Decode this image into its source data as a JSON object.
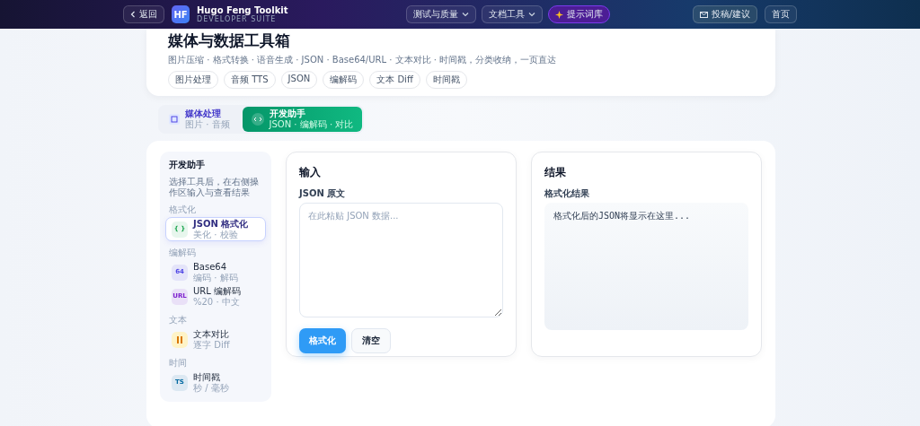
{
  "header": {
    "back": "返回",
    "logo": "HF",
    "title": "Hugo Feng Toolkit",
    "subtitle": "DEVELOPER SUITE",
    "nav": [
      {
        "label": "测试与质量",
        "kind": "dropdown"
      },
      {
        "label": "文档工具",
        "kind": "dropdown"
      },
      {
        "label": "提示词库",
        "kind": "highlight"
      }
    ],
    "actions": [
      {
        "label": "投稿/建议",
        "kind": "mail"
      },
      {
        "label": "首页",
        "kind": "plain"
      }
    ]
  },
  "hero": {
    "title": "媒体与数据工具箱",
    "description": "图片压缩 · 格式转换 · 语音生成 · JSON · Base64/URL · 文本对比 · 时间戳，分类收纳，一页直达",
    "chips": [
      "图片处理",
      "音频 TTS",
      "JSON",
      "编解码",
      "文本 Diff",
      "时间戳"
    ]
  },
  "tabs": [
    {
      "label": "媒体处理",
      "sub": "图片 · 音频",
      "selected": false
    },
    {
      "label": "开发助手",
      "sub": "JSON · 编解码 · 对比",
      "selected": true
    }
  ],
  "sidebar": {
    "title": "开发助手",
    "description": "选择工具后，在右侧操作区输入与查看结果",
    "groups": [
      {
        "label": "格式化",
        "items": [
          {
            "badge": "{ }",
            "name": "JSON 格式化",
            "sub": "美化 · 校验",
            "selected": true,
            "color": "#16a34a"
          }
        ]
      },
      {
        "label": "编解码",
        "items": [
          {
            "badge": "64",
            "name": "Base64",
            "sub": "编码 · 解码",
            "selected": false,
            "color": "#4f46e5"
          },
          {
            "badge": "URL",
            "name": "URL 编解码",
            "sub": "%20 · 中文",
            "selected": false,
            "color": "#7e22ce"
          }
        ]
      },
      {
        "label": "文本",
        "items": [
          {
            "name": "文本对比",
            "sub": "逐字 Diff",
            "selected": false,
            "color": "#d97706"
          }
        ]
      },
      {
        "label": "时间",
        "items": [
          {
            "badge": "TS",
            "name": "时间戳",
            "sub": "秒 / 毫秒",
            "selected": false,
            "color": "#0369a1"
          }
        ]
      }
    ]
  },
  "input": {
    "title": "输入",
    "label": "JSON 原文",
    "placeholder": "在此粘贴 JSON 数据...",
    "buttons": [
      {
        "label": "格式化",
        "kind": "primary"
      },
      {
        "label": "清空",
        "kind": "secondary"
      }
    ]
  },
  "result": {
    "title": "结果",
    "label": "格式化结果",
    "text": "格式化后的JSON将显示在这里..."
  }
}
